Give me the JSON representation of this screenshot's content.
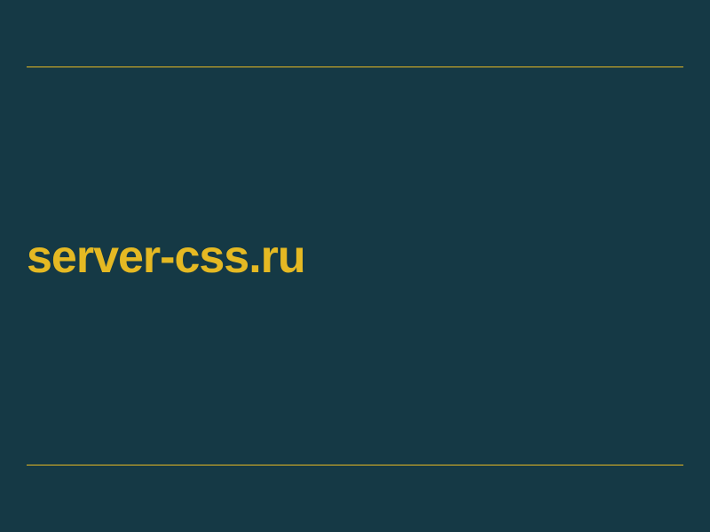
{
  "domain": "server-css.ru",
  "colors": {
    "background": "#153945",
    "accent": "#e5b923"
  }
}
